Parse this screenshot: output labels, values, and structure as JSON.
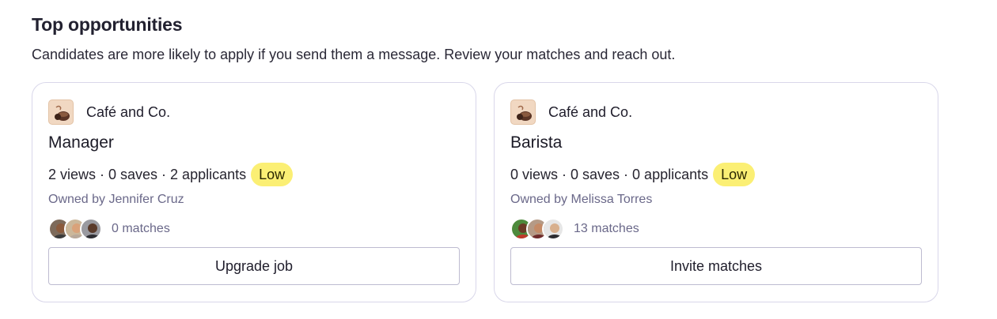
{
  "section": {
    "title": "Top opportunities",
    "subtitle": "Candidates are more likely to apply if you send them a message. Review your matches and reach out."
  },
  "cards": [
    {
      "company": "Café and Co.",
      "job_title": "Manager",
      "stats": "2 views · 0 saves · 2 applicants",
      "badge": "Low",
      "owner": "Owned by Jennifer Cruz",
      "matches": "0 matches",
      "button": "Upgrade job"
    },
    {
      "company": "Café and Co.",
      "job_title": "Barista",
      "stats": "0 views · 0 saves · 0 applicants",
      "badge": "Low",
      "owner": "Owned by Melissa Torres",
      "matches": "13 matches",
      "button": "Invite matches"
    }
  ],
  "icons": {
    "company_logo": "coffee-cup-logo-icon",
    "avatar": "candidate-avatar"
  },
  "colors": {
    "badge_bg": "#fbef74",
    "card_border": "#d9d7ea",
    "muted_text": "#6a6889"
  }
}
